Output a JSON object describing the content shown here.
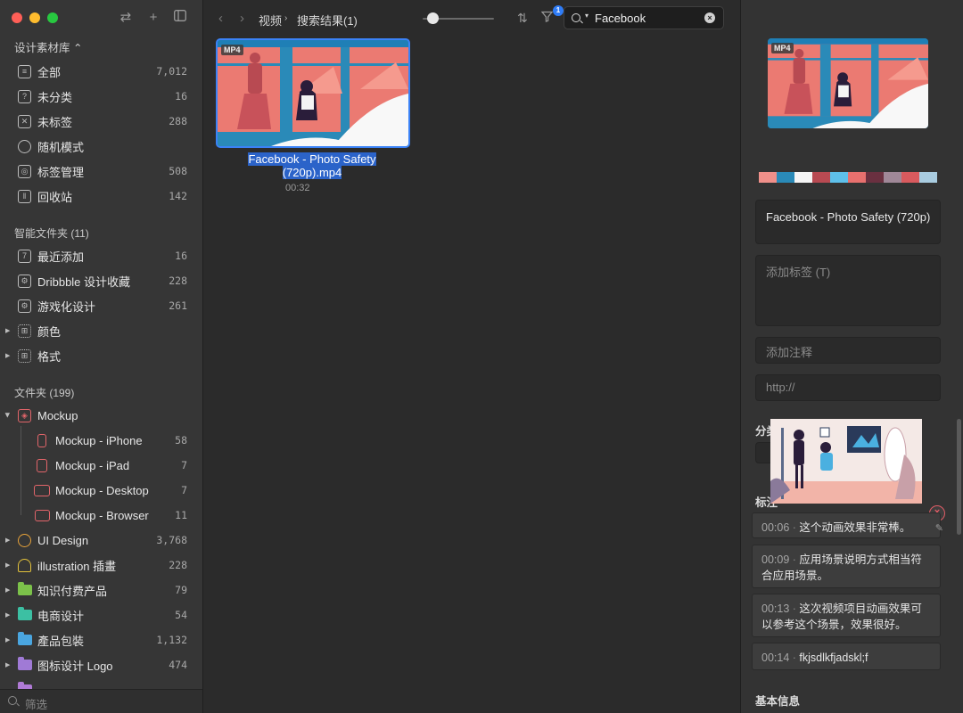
{
  "sidebar": {
    "library_title": "设计素材库 ⌃",
    "top_items": [
      {
        "label": "全部",
        "count": "7,012"
      },
      {
        "label": "未分类",
        "count": "16"
      },
      {
        "label": "未标签",
        "count": "288"
      },
      {
        "label": "随机模式",
        "count": ""
      },
      {
        "label": "标签管理",
        "count": "508"
      },
      {
        "label": "回收站",
        "count": "142"
      }
    ],
    "smart_title": "智能文件夹 (11)",
    "smart_items": [
      {
        "label": "最近添加",
        "count": "16"
      },
      {
        "label": "Dribbble 设计收藏",
        "count": "228"
      },
      {
        "label": "游戏化设计",
        "count": "261"
      },
      {
        "label": "颜色",
        "count": ""
      },
      {
        "label": "格式",
        "count": ""
      }
    ],
    "folders_title": "文件夹 (199)",
    "mockup": {
      "label": "Mockup",
      "count": ""
    },
    "mockup_children": [
      {
        "label": "Mockup - iPhone",
        "count": "58"
      },
      {
        "label": "Mockup - iPad",
        "count": "7"
      },
      {
        "label": "Mockup - Desktop",
        "count": "7"
      },
      {
        "label": "Mockup - Browser",
        "count": "11"
      }
    ],
    "folders": [
      {
        "label": "UI Design",
        "count": "3,768",
        "color": "#e8a33a"
      },
      {
        "label": "illustration 插畫",
        "count": "228",
        "color": "#e3c23b"
      },
      {
        "label": "知识付费产品",
        "count": "79",
        "color": "#7cc24a"
      },
      {
        "label": "电商设计",
        "count": "54",
        "color": "#3cc0a3"
      },
      {
        "label": "產品包裝",
        "count": "1,132",
        "color": "#4aa6e0"
      },
      {
        "label": "图标设计 Logo",
        "count": "474",
        "color": "#a07ad6"
      }
    ],
    "filter_placeholder": "筛选"
  },
  "toolbar": {
    "crumb_root": "视频",
    "crumb_current": "搜索结果(1)",
    "filter_badge": "1",
    "search_value": "Facebook"
  },
  "item": {
    "format": "MP4",
    "name": "Facebook - Photo Safety (720p).mp4",
    "duration": "00:32"
  },
  "inspector": {
    "format": "MP4",
    "palette": [
      "#f0908a",
      "#2a8ab8",
      "#f5f5f5",
      "#b84a52",
      "#5ec0ea",
      "#e8706e",
      "#6a3040",
      "#a08898",
      "#d85a5e",
      "#a9cce0"
    ],
    "title_value": "Facebook - Photo Safety (720p)",
    "tags_placeholder": "添加标签 (T)",
    "note_placeholder": "添加注释",
    "url_placeholder": "http://",
    "folder_label_partial": "分类",
    "comments_label_partial": "标注",
    "comments": [
      {
        "ts": "00:06",
        "text": "这个动画效果非常棒。"
      },
      {
        "ts": "00:09",
        "text": "应用场景说明方式相当符合应用场景。"
      },
      {
        "ts": "00:13",
        "text": "这次视频项目动画效果可以参考这个场景，效果很好。"
      },
      {
        "ts": "00:14",
        "text": "fkjsdlkfjadskl;f"
      }
    ],
    "basic_info_label": "基本信息"
  }
}
